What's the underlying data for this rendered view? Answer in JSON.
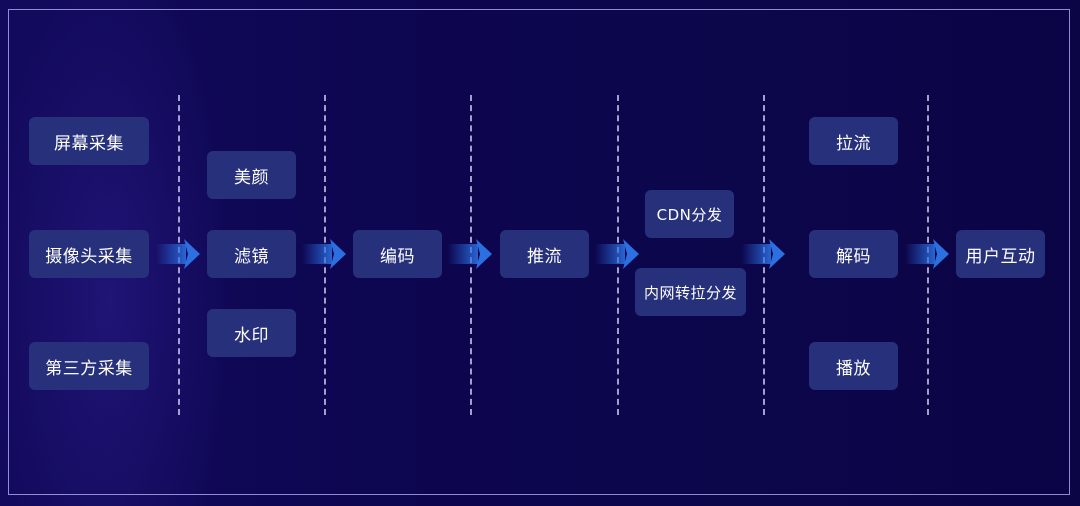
{
  "stages": {
    "capture": {
      "items": [
        "屏幕采集",
        "摄像头采集",
        "第三方采集"
      ]
    },
    "processing": {
      "items": [
        "美颜",
        "滤镜",
        "水印"
      ]
    },
    "encode": {
      "label": "编码"
    },
    "push": {
      "label": "推流"
    },
    "distribution": {
      "items": [
        "CDN分发",
        "内网转拉分发"
      ]
    },
    "client": {
      "items": [
        "拉流",
        "解码",
        "播放"
      ]
    },
    "interaction": {
      "label": "用户互动"
    }
  },
  "colors": {
    "background": "#0b0544",
    "node_fill": "#27307a",
    "arrow": "#2b6fe0",
    "divider": "#c8c8eb"
  }
}
